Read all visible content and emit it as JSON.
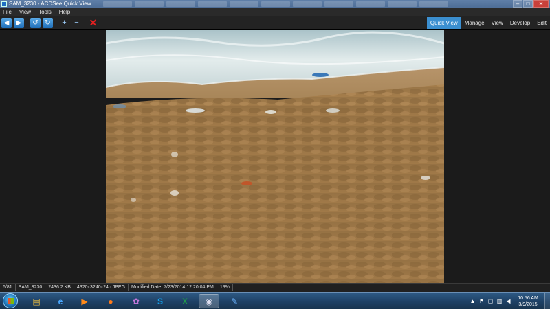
{
  "window": {
    "title": "SAM_3230 - ACDSee Quick View",
    "controls": {
      "minimize": "–",
      "maximize": "□",
      "close": "✕"
    }
  },
  "menu": [
    "File",
    "View",
    "Tools",
    "Help"
  ],
  "toolbar": {
    "buttons": [
      {
        "icon": "previous-icon",
        "glyph": "◀"
      },
      {
        "icon": "next-icon",
        "glyph": "▶"
      },
      {
        "icon": "rotate-left-icon",
        "glyph": "↺"
      },
      {
        "icon": "rotate-right-icon",
        "glyph": "↻"
      },
      {
        "icon": "zoom-in-icon",
        "glyph": "+"
      },
      {
        "icon": "zoom-out-icon",
        "glyph": "−"
      },
      {
        "icon": "delete-icon",
        "glyph": "✕"
      }
    ],
    "modes": [
      "Quick View",
      "Manage",
      "View",
      "Develop",
      "Edit"
    ],
    "active_mode": "Quick View"
  },
  "statusbar": [
    "6/81",
    "SAM_3230",
    "2436.2 KB",
    "4320x3240x24b JPEG",
    "Modified Date: 7/23/2014 12:20:04 PM",
    "19%"
  ],
  "taskbar": {
    "apps": [
      {
        "icon": "folder-icon",
        "glyph": "▤",
        "color": "#f0c040"
      },
      {
        "icon": "internet-explorer-icon",
        "glyph": "e",
        "color": "#4aa8ff"
      },
      {
        "icon": "media-player-icon",
        "glyph": "▶",
        "color": "#ff8a1a"
      },
      {
        "icon": "firefox-icon",
        "glyph": "●",
        "color": "#ff7a1a"
      },
      {
        "icon": "paint-icon",
        "glyph": "✿",
        "color": "#c678dd"
      },
      {
        "icon": "skype-icon",
        "glyph": "S",
        "color": "#14a3ee"
      },
      {
        "icon": "excel-icon",
        "glyph": "X",
        "color": "#1f9b4a"
      },
      {
        "icon": "acdsee-icon",
        "glyph": "◉",
        "color": "#9ab"
      },
      {
        "icon": "paint-net-icon",
        "glyph": "✎",
        "color": "#6cb4ff"
      }
    ],
    "active_app": "acdsee-icon",
    "clock_time": "10:56 AM",
    "clock_date": "3/9/2015"
  },
  "colors": {
    "accent": "#3b8fd0",
    "sand": "#a9824f",
    "water": "#cfdde0"
  }
}
